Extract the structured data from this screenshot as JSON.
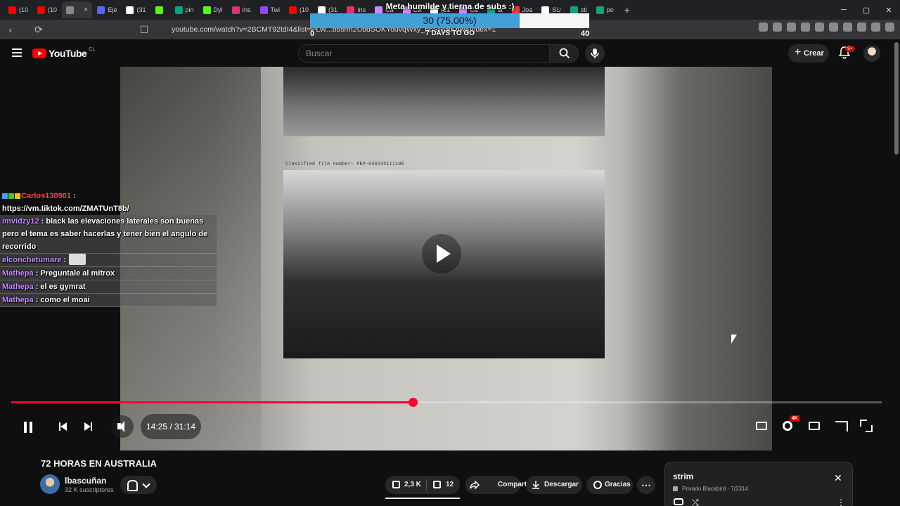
{
  "browser": {
    "tabs": [
      {
        "label": "(10",
        "color": "#ff0000"
      },
      {
        "label": "(10",
        "color": "#ff0000"
      },
      {
        "label": "",
        "color": "#888888",
        "active": true
      },
      {
        "label": "Eje",
        "color": "#5865f2"
      },
      {
        "label": "(31",
        "color": "#ffffff"
      },
      {
        "label": "",
        "color": "#53fc18"
      },
      {
        "label": "pin",
        "color": "#00a67e"
      },
      {
        "label": "Dyl",
        "color": "#53fc18"
      },
      {
        "label": "Ins",
        "color": "#e1306c"
      },
      {
        "label": "Twi",
        "color": "#9146ff"
      },
      {
        "label": "(10",
        "color": "#ff0000"
      },
      {
        "label": "(31",
        "color": "#ffffff"
      },
      {
        "label": "Ins",
        "color": "#e1306c"
      },
      {
        "label": "Ca",
        "color": "#c78bff"
      },
      {
        "label": "Ca",
        "color": "#c78bff"
      },
      {
        "label": "(31",
        "color": "#ffffff"
      },
      {
        "label": "Ca",
        "color": "#c78bff"
      },
      {
        "label": "la",
        "color": "#10a37f"
      },
      {
        "label": "Joa",
        "color": "#e53935"
      },
      {
        "label": "SU",
        "color": "#ffffff"
      },
      {
        "label": "sti",
        "color": "#10a37f"
      },
      {
        "label": "po",
        "color": "#10a37f"
      }
    ],
    "url": "youtube.com/watch?v=2BCMT92tdI4&list=PLW...bbsrm2UbdSOKYouvqWxy_bbSHykKhw&index=1"
  },
  "goal": {
    "title": "Meta humilde y tierna de subs :)",
    "progress_text": "30 (75.00%)",
    "progress_fraction": 0.75,
    "min": "0",
    "max": "40",
    "days_left": "7 DAYS TO GO",
    "fill_color": "#41a0d8"
  },
  "youtube": {
    "logo_text": "YouTube",
    "region": "CL",
    "search_placeholder": "Buscar",
    "create_label": "Crear",
    "notif_badge": "9+"
  },
  "video": {
    "classified_text": "Classified file number: PEP-030335111106",
    "time": "14:25 / 31:14",
    "progress_fraction": 0.461,
    "quality_badge": "4K",
    "accent": "#ff0033"
  },
  "chat": [
    {
      "user": "Carlos130901",
      "text": ":",
      "color": "#ff4b4b",
      "badges": true
    },
    {
      "user": "",
      "text": "https://vm.tiktok.com/ZMATUnT8b/",
      "color": "#ffffff"
    },
    {
      "user": "imvidzy12",
      "text": ": black las elevaciones laterales son buenas pero el tema es saber hacerlas y tener bien el angulo de recorrido",
      "color": "#c58aff",
      "boxed": true
    },
    {
      "user": "elconchetumare",
      "text": ":",
      "color": "#c58aff",
      "boxed": true,
      "emote": true
    },
    {
      "user": "Mathepa",
      "text": ": Preguntale al mitrox",
      "color": "#c58aff",
      "boxed": true
    },
    {
      "user": "Mathepa",
      "text": ": el es gymrat",
      "color": "#c58aff",
      "boxed": true
    },
    {
      "user": "Mathepa",
      "text": ": como el moai",
      "color": "#c58aff",
      "boxed": true
    }
  ],
  "meta": {
    "title": "72 HORAS EN AUSTRALIA",
    "channel": "lbascuñan",
    "subscribers": "32 K suscriptores",
    "likes": "2,3 K",
    "dislikes": "12",
    "share": "Compartir",
    "download": "Descargar",
    "thanks": "Gracias"
  },
  "playlist": {
    "title": "strim",
    "meta": "Privado Blackbird - 7/2314"
  }
}
